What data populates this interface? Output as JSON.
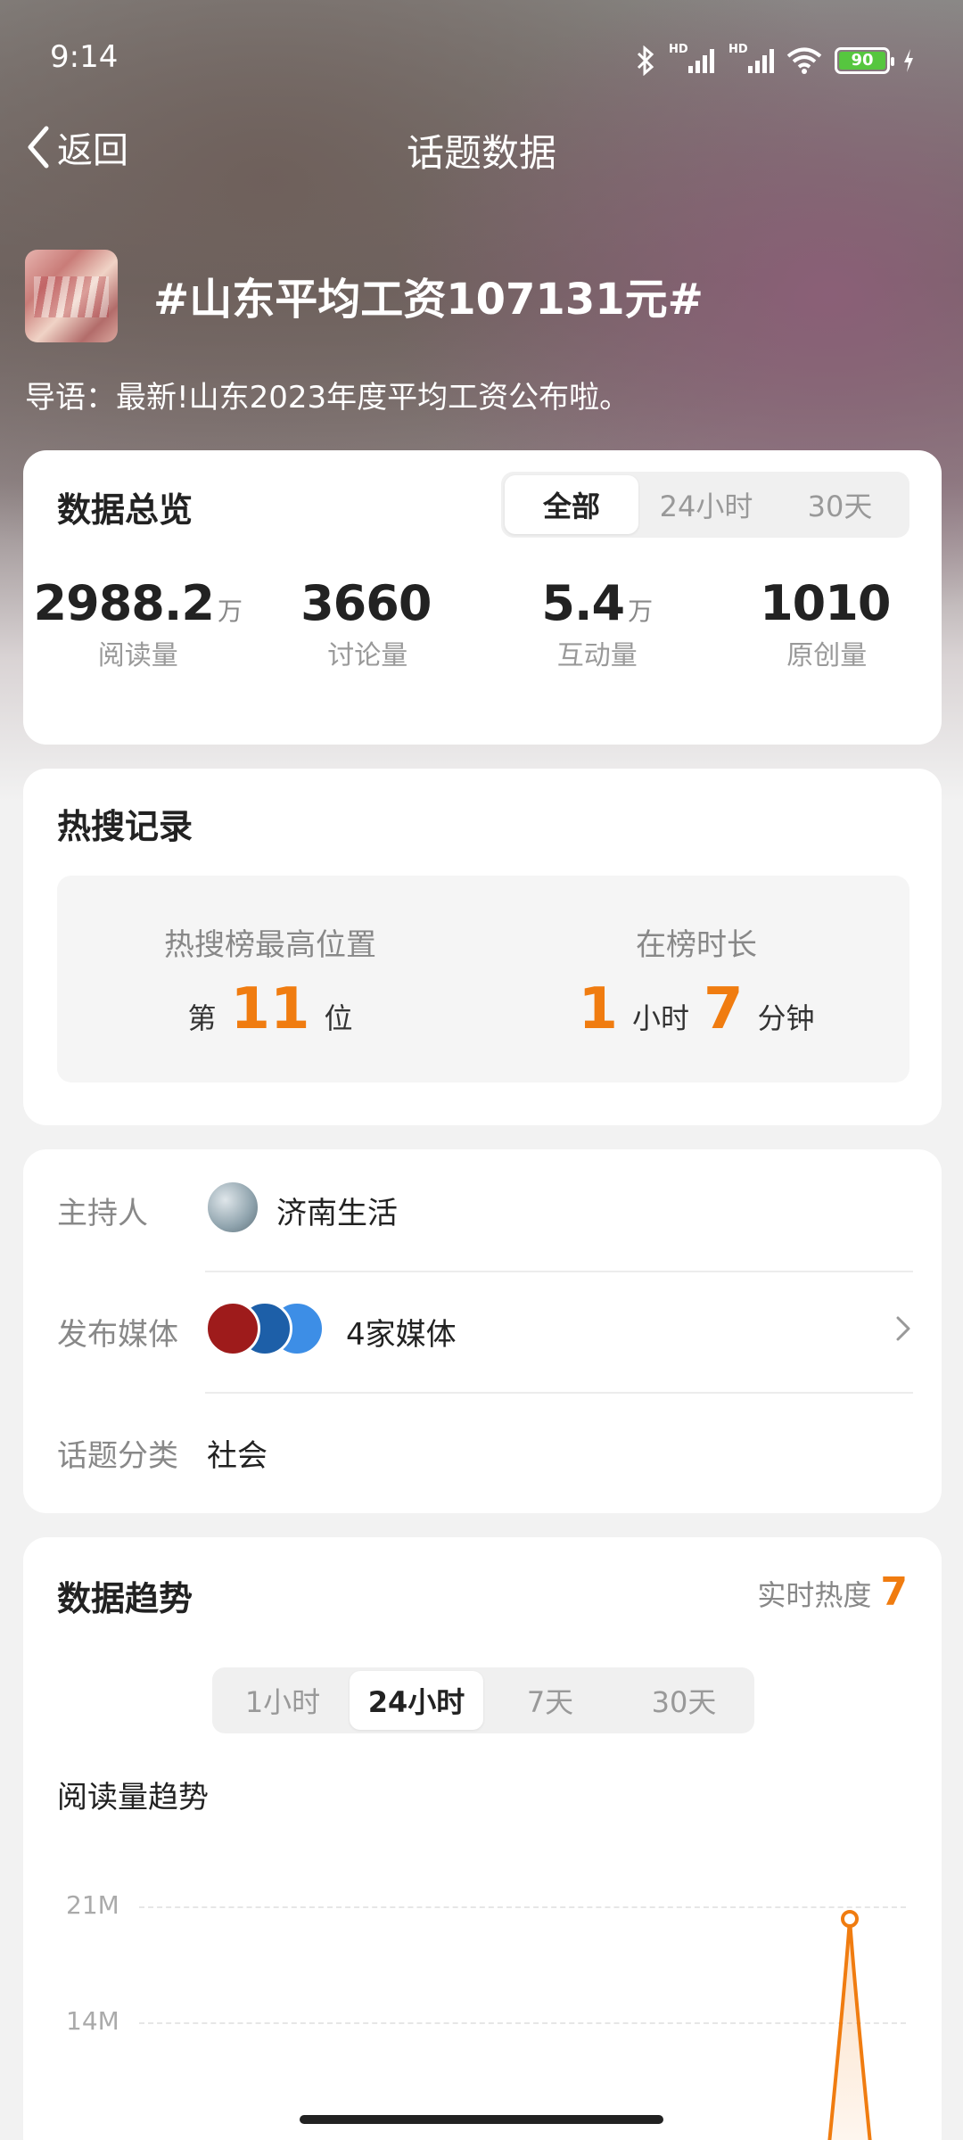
{
  "status_bar": {
    "time": "9:14",
    "battery": "90",
    "hd1": "HD",
    "hd2": "HD"
  },
  "nav": {
    "back_label": "返回",
    "title": "话题数据"
  },
  "topic": {
    "title": "#山东平均工资107131元#",
    "lead": "导语：最新!山东2023年度平均工资公布啦。"
  },
  "overview": {
    "title": "数据总览",
    "tabs": [
      "全部",
      "24小时",
      "30天"
    ],
    "active_tab": "全部",
    "stats": [
      {
        "value": "2988.2",
        "unit": "万",
        "label": "阅读量"
      },
      {
        "value": "3660",
        "unit": "",
        "label": "讨论量"
      },
      {
        "value": "5.4",
        "unit": "万",
        "label": "互动量"
      },
      {
        "value": "1010",
        "unit": "",
        "label": "原创量"
      }
    ]
  },
  "hot_search": {
    "title": "热搜记录",
    "peak_label": "热搜榜最高位置",
    "peak_prefix": "第",
    "peak_value": "11",
    "peak_suffix": "位",
    "duration_label": "在榜时长",
    "hours": "1",
    "hours_unit": "小时",
    "minutes": "7",
    "minutes_unit": "分钟"
  },
  "info": {
    "host_label": "主持人",
    "host_name": "济南生活",
    "media_label": "发布媒体",
    "media_value": "4家媒体",
    "category_label": "话题分类",
    "category_value": "社会"
  },
  "trend": {
    "title": "数据趋势",
    "heat_label": "实时热度",
    "heat_value": "7",
    "tabs": [
      "1小时",
      "24小时",
      "7天",
      "30天"
    ],
    "active_tab": "24小时",
    "chart_title": "阅读量趋势"
  },
  "chart_data": {
    "type": "line",
    "title": "阅读量趋势",
    "y_ticks": [
      "21M",
      "14M"
    ],
    "series": [
      {
        "values": [
          0,
          20000000
        ]
      }
    ],
    "color": "#f07c10"
  },
  "colors": {
    "accent": "#f07c10",
    "card": "#ffffff",
    "page_bg": "#f2f2f2"
  }
}
